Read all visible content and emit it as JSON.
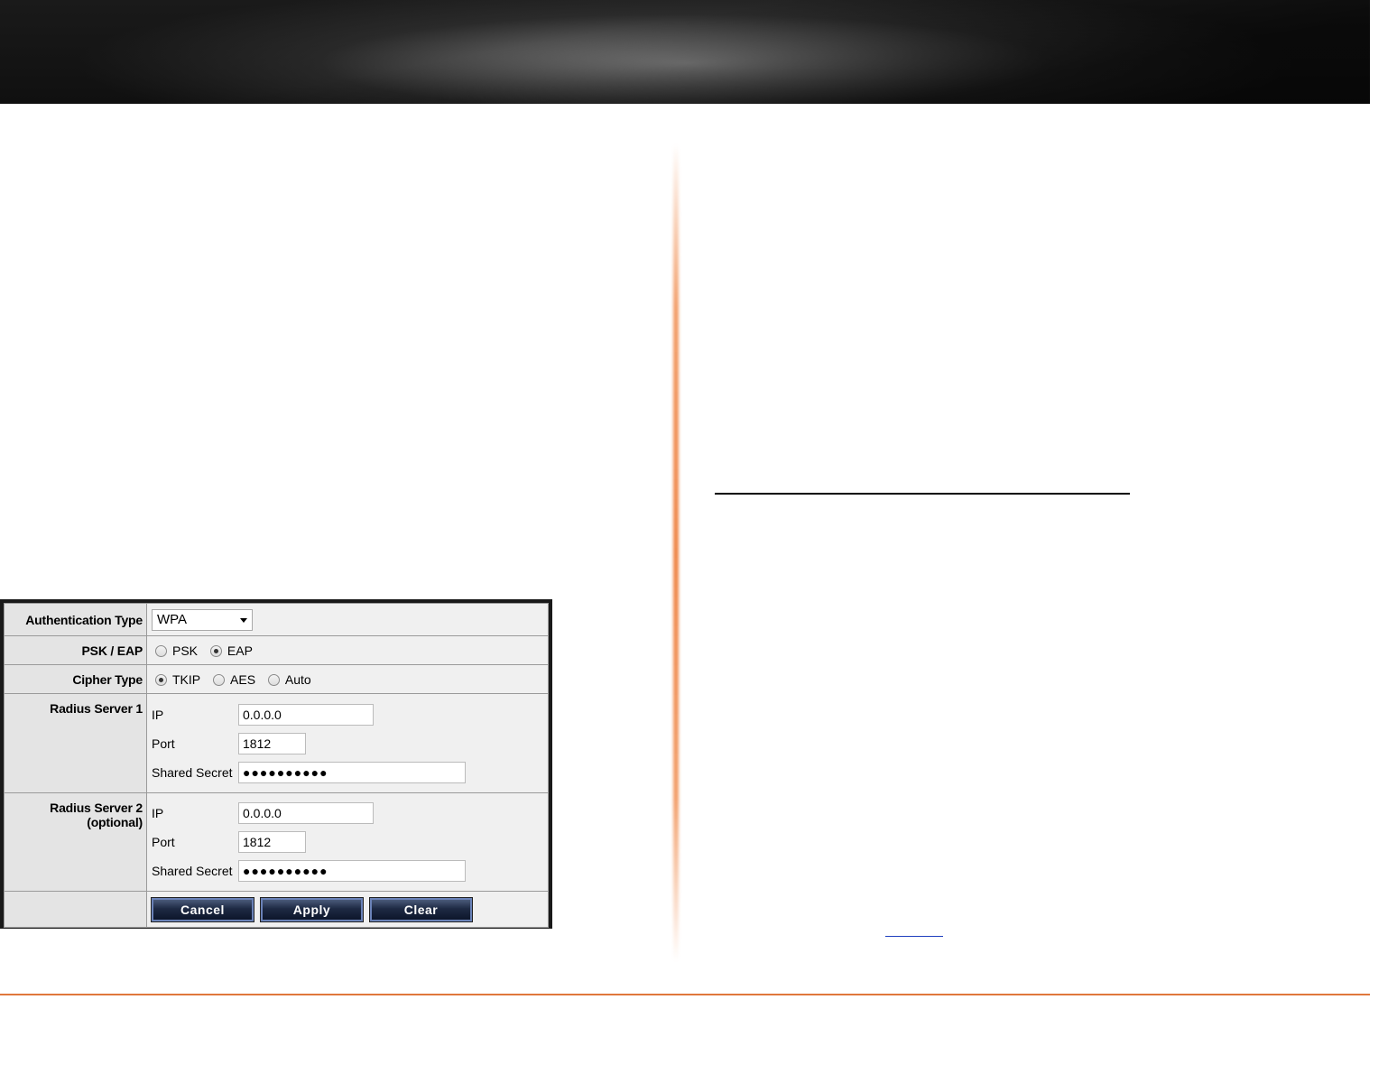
{
  "settings": {
    "rows": {
      "authentication_type": {
        "label": "Authentication Type",
        "selected": "WPA"
      },
      "psk_eap": {
        "label": "PSK / EAP",
        "options": [
          "PSK",
          "EAP"
        ],
        "selected": "EAP"
      },
      "cipher_type": {
        "label": "Cipher Type",
        "options": [
          "TKIP",
          "AES",
          "Auto"
        ],
        "selected": "TKIP"
      },
      "radius_server_1": {
        "label": "Radius Server 1",
        "ip_label": "IP",
        "ip": "0.0.0.0",
        "port_label": "Port",
        "port": "1812",
        "secret_label": "Shared Secret",
        "secret": "●●●●●●●●●●"
      },
      "radius_server_2": {
        "label_line1": "Radius Server 2",
        "label_line2": "(optional)",
        "ip_label": "IP",
        "ip": "0.0.0.0",
        "port_label": "Port",
        "port": "1812",
        "secret_label": "Shared Secret",
        "secret": "●●●●●●●●●●"
      }
    },
    "buttons": {
      "cancel": "Cancel",
      "apply": "Apply",
      "clear": "Clear"
    }
  },
  "colors": {
    "accent_orange": "#e0783c",
    "button_navy": "#1e2a44",
    "panel_bg": "#f0f0f0"
  }
}
